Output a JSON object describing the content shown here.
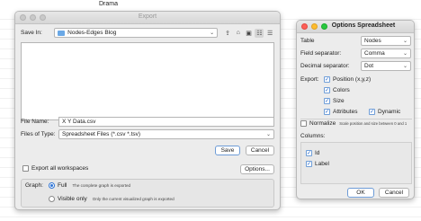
{
  "background": {
    "label": "Drama"
  },
  "export_window": {
    "title": "Export",
    "save_in_label": "Save In:",
    "save_in_value": "Nodes-Edges Blog",
    "file_name_label": "File Name:",
    "file_name_value": "X Y Data.csv",
    "files_of_type_label": "Files of Type:",
    "files_of_type_value": "Spreadsheet Files (*.csv *.tsv)",
    "save_button": "Save",
    "cancel_button": "Cancel",
    "export_all_label": "Export all workspaces",
    "options_button": "Options...",
    "graph_label": "Graph:",
    "full_label": "Full",
    "full_hint": "The complete graph is exported",
    "visible_only_label": "Visible only",
    "visible_only_hint": "Only the current visualized graph is exported"
  },
  "options_window": {
    "title": "Options Spreadsheet",
    "table_label": "Table",
    "table_value": "Nodes",
    "field_sep_label": "Field separator:",
    "field_sep_value": "Comma",
    "decimal_sep_label": "Decimal separator:",
    "decimal_sep_value": "Dot",
    "export_label": "Export:",
    "position_label": "Position (x,y,z)",
    "colors_label": "Colors",
    "size_label": "Size",
    "attributes_label": "Attributes",
    "dynamic_label": "Dynamic",
    "normalize_label": "Normalize",
    "normalize_hint": "Scale position and size between 0 and 1",
    "columns_label": "Columns:",
    "col_id_label": "Id",
    "col_label_label": "Label",
    "ok_button": "OK",
    "cancel_button": "Cancel"
  },
  "colors": {
    "accent": "#2e74d6",
    "folder": "#6aa8e6"
  }
}
